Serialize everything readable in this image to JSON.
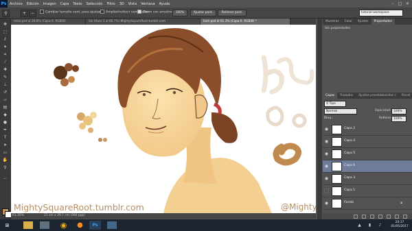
{
  "app": {
    "logo": "Ps"
  },
  "menu": [
    "Archivo",
    "Edición",
    "Imagen",
    "Capa",
    "Texto",
    "Selección",
    "Filtro",
    "3D",
    "Vista",
    "Ventana",
    "Ayuda"
  ],
  "options": {
    "resize_windows": "Cambiar tamaño vent. para ajustar",
    "zoom_all": "Ampliar/reducir vent. todas",
    "scrubby_zoom": "Zoom con arrastre",
    "zoom_level": "100%",
    "fit_screen": "Ajustar pant.",
    "fill_screen": "Rellenar pant.",
    "workspace": "tutorial workspace"
  },
  "tabs": [
    "mike.psd al 28,6% (Capa 6, RGB/8)",
    "Sin título-1 al 66,7% (MightySquareRoot.tumblr.com",
    "liam.psd al 61,3% (Capa 6, RGB/8) *"
  ],
  "canvas": {
    "watermark_left": "MightySquareRoot.tumblr.com",
    "watermark_right": "@MightySRoot",
    "palette_colors": [
      "#5a3418",
      "#8a5030",
      "#7b4424",
      "#a86a3c",
      "#c78a4e",
      "#d7a865",
      "#e8c27e",
      "#f1d79a",
      "#e9c683",
      "#ddb070",
      "#b98a55"
    ]
  },
  "status": {
    "zoom": "61,35%",
    "doc_info": "21 cm x 29,7 cm (300 ppp)"
  },
  "props_panel": {
    "tabs": [
      "Muestras",
      "Color",
      "Ajustes",
      "Propiedades"
    ],
    "empty_label": "Sin propiedades"
  },
  "layers_panel": {
    "tabs": [
      "Capas",
      "Trazados",
      "Ajustes preestablecidos c",
      "Pincel"
    ],
    "filter_type": "Tipo",
    "blend_mode": "Normal",
    "opacity_label": "Opacidad:",
    "opacity_value": "100%",
    "lock_label": "Bloq.:",
    "fill_label": "Relleno:",
    "fill_value": "100%",
    "layers": [
      {
        "name": "Capa 2",
        "visible": true,
        "active": false
      },
      {
        "name": "Capa 4",
        "visible": true,
        "active": false
      },
      {
        "name": "Capa 5",
        "visible": true,
        "active": false
      },
      {
        "name": "Capa 6",
        "visible": true,
        "active": true
      },
      {
        "name": "Capa 3",
        "visible": true,
        "active": false
      },
      {
        "name": "Capa 1",
        "visible": false,
        "active": false
      },
      {
        "name": "Fondo",
        "visible": true,
        "active": false,
        "locked": true
      }
    ]
  },
  "taskbar": {
    "apps": [
      "start-icon",
      "file-explorer-icon",
      "media-icon",
      "chrome-icon",
      "firefox-icon",
      "photoshop-icon",
      "image-viewer-icon"
    ],
    "time": "20:17",
    "date": "01/05/2017"
  }
}
